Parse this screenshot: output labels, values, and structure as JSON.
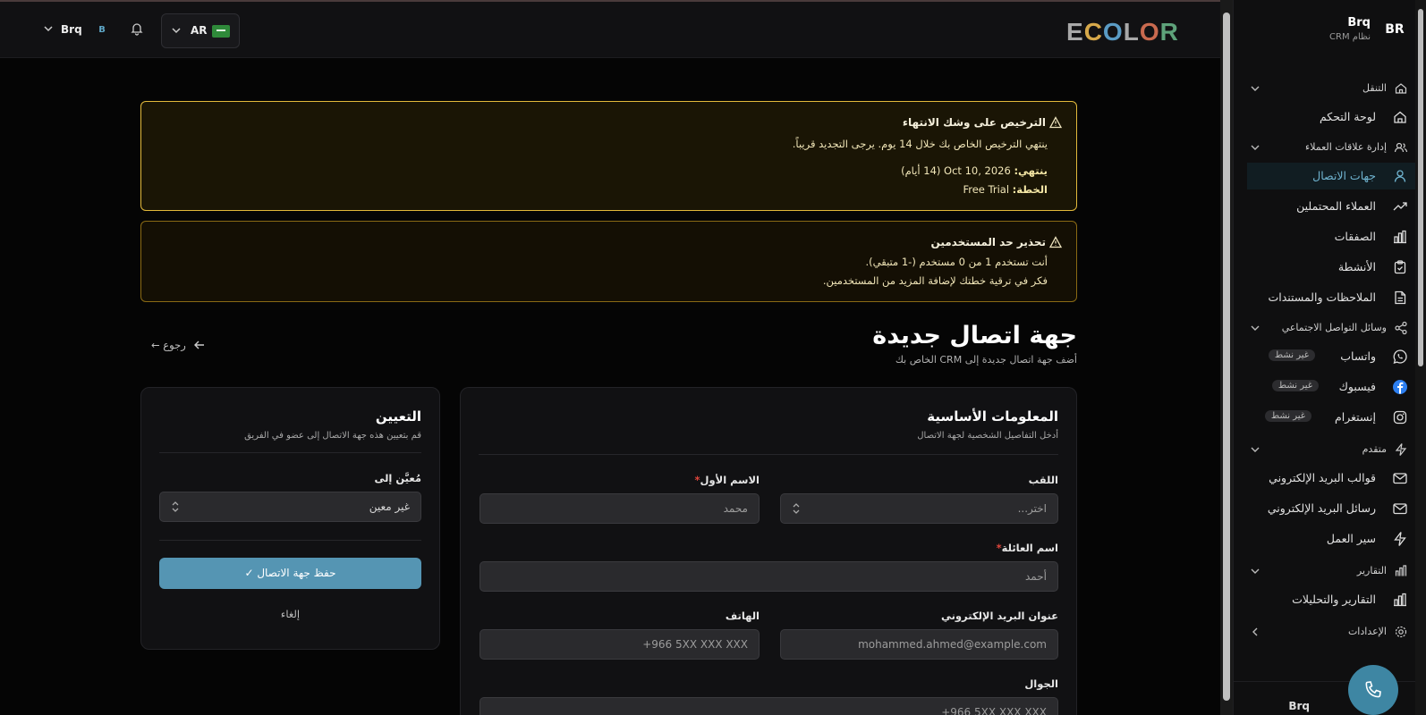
{
  "brand": {
    "initials": "BR",
    "name": "Brq",
    "subtitle": "نظام CRM"
  },
  "topbar": {
    "logo_letters": [
      {
        "ch": "E",
        "color": "#a8a8a8"
      },
      {
        "ch": "C",
        "color": "#d6a84a"
      },
      {
        "ch": "O",
        "color": "#5a9bc4"
      },
      {
        "ch": "L",
        "color": "#a8a8a8"
      },
      {
        "ch": "O",
        "color": "#c96a4f"
      },
      {
        "ch": "R",
        "color": "#5ea27a"
      }
    ],
    "user_name": "Brq",
    "user_initial": "B",
    "language_code": "AR"
  },
  "sidebar": {
    "groups": {
      "navigation": "التنقل",
      "crm": "إدارة علاقات العملاء",
      "social": "وسائل التواصل الاجتماعي",
      "advanced": "متقدم",
      "reports": "التقارير",
      "settings": "الإعدادات"
    },
    "items": {
      "dashboard": "لوحة التحكم",
      "contacts": "جهات الاتصال",
      "leads": "العملاء المحتملين",
      "deals": "الصفقات",
      "activities": "الأنشطة",
      "notes": "الملاحظات والمستندات",
      "whatsapp": "واتساب",
      "facebook": "فيسبوك",
      "instagram": "إنستغرام",
      "email_templates": "قوالب البريد الإلكتروني",
      "email_messages": "رسائل البريد الإلكتروني",
      "workflow": "سير العمل",
      "analytics": "التقارير والتحليلات"
    },
    "inactive_badge": "غير نشط",
    "footer_label": "Brq"
  },
  "alerts": {
    "license": {
      "title": "الترخيص على وشك الانتهاء",
      "message": "ينتهي الترخيص الخاص بك خلال 14 يوم. يرجى التجديد قريباً.",
      "expires_label": "ينتهي:",
      "expires_value": "Oct 10, 2026 (14 أيام)",
      "plan_label": "الخطة:",
      "plan_value": "Free Trial"
    },
    "users": {
      "title": "تحذير حد المستخدمين",
      "line1": "أنت تستخدم 1 من 0 مستخدم (-1 متبقي).",
      "line2": "فكر في ترقية خطتك لإضافة المزيد من المستخدمين."
    }
  },
  "page": {
    "title": "جهة اتصال جديدة",
    "subtitle": "أضف جهة اتصال جديدة إلى CRM الخاص بك",
    "back": "← رجوع"
  },
  "basic_info": {
    "title": "المعلومات الأساسية",
    "subtitle": "أدخل التفاصيل الشخصية لجهة الاتصال",
    "title_label": "اللقب",
    "title_placeholder": "اختر...",
    "first_name_label": "الاسم الأول",
    "first_name_placeholder": "محمد",
    "last_name_label": "اسم العائلة",
    "last_name_placeholder": "أحمد",
    "email_label": "عنوان البريد الإلكتروني",
    "email_placeholder": "mohammed.ahmed@example.com",
    "phone_label": "الهاتف",
    "phone_placeholder": "+966 5XX XXX XXX",
    "mobile_label": "الجوال",
    "mobile_placeholder": "+966 5XX XXX XXX",
    "required_mark": "*"
  },
  "assignment": {
    "title": "التعيين",
    "subtitle": "قم بتعيين هذه جهة الاتصال إلى عضو في الفريق",
    "assigned_label": "مُعيَّن إلى",
    "assigned_value": "غير معين",
    "save_label": "حفظ جهة الاتصال ✓",
    "cancel_label": "إلغاء"
  }
}
